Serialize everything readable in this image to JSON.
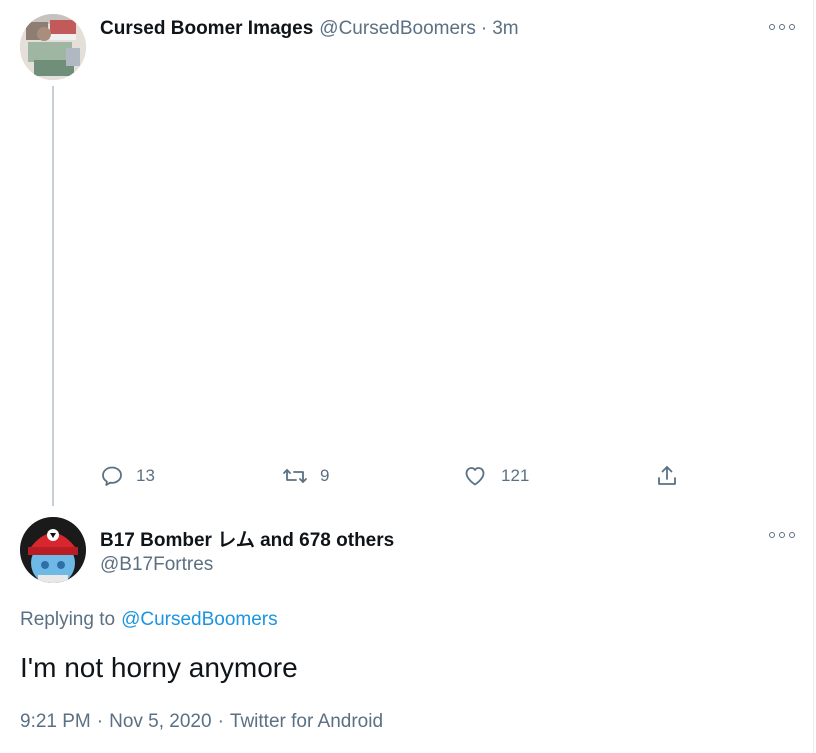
{
  "tweet1": {
    "name": "Cursed Boomer Images",
    "handle": "@CursedBoomers",
    "separator": "·",
    "time": "3m",
    "actions": {
      "reply_count": "13",
      "retweet_count": "9",
      "like_count": "121"
    },
    "icons": [
      "reply-icon",
      "retweet-icon",
      "like-icon",
      "share-icon",
      "more-icon"
    ]
  },
  "tweet2": {
    "name": "B17 Bomber レム and 678 others",
    "handle": "@B17Fortres",
    "replying_prefix": "Replying to",
    "replying_handle": "@CursedBoomers",
    "text": "I'm not horny anymore",
    "time": "9:21 PM",
    "date": "Nov 5, 2020",
    "source": "Twitter for Android",
    "meta_separator": "·"
  },
  "colors": {
    "text_primary": "#0f1419",
    "text_secondary": "#5b7083",
    "link": "#1b95e0",
    "thread_line": "#c4cfd6"
  }
}
